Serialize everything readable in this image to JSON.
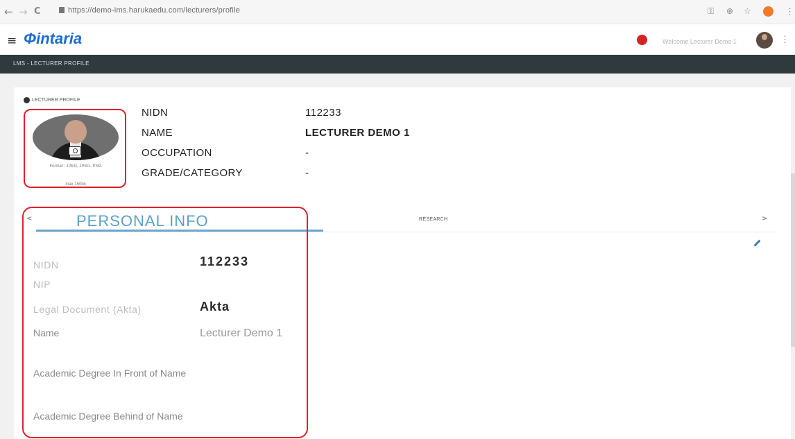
{
  "browser": {
    "back": "←",
    "forward": "→",
    "reload": "C",
    "url": "https://demo-ims.harukaedu.com/lecturers/profile"
  },
  "header": {
    "logo": "intaria",
    "welcome": "Welcome Lecturer Demo 1"
  },
  "breadcrumb": "LMS - LECTURER PROFILE",
  "profile": {
    "section_label": "LECTURER PROFILE",
    "photo_caption_1": "Format : JPEG, JPEG, PNG",
    "photo_caption_2": "max 150kb",
    "fields": [
      {
        "label": "NIDN",
        "value": "112233"
      },
      {
        "label": "NAME",
        "value": "LECTURER DEMO 1"
      },
      {
        "label": "OCCUPATION",
        "value": "-"
      },
      {
        "label": "GRADE/CATEGORY",
        "value": "-"
      }
    ]
  },
  "tabs": {
    "prev": "<",
    "next": ">",
    "personal": "PERSONAL INFO",
    "research": "RESEARCH"
  },
  "personal_info": {
    "nidn_label": "NIDN",
    "nidn_value": "112233",
    "nip_label": "NIP",
    "akta_label": "Legal Document (Akta)",
    "akta_value": "Akta",
    "name_label": "Name",
    "name_value": "Lecturer Demo 1",
    "degree_front_label": "Academic Degree In Front of Name",
    "degree_behind_label": "Academic Degree Behind of Name"
  },
  "colors": {
    "accent": "#5aa0c8",
    "highlight": "#e0202b",
    "breadcrumb_bg": "#2f3a3f"
  }
}
